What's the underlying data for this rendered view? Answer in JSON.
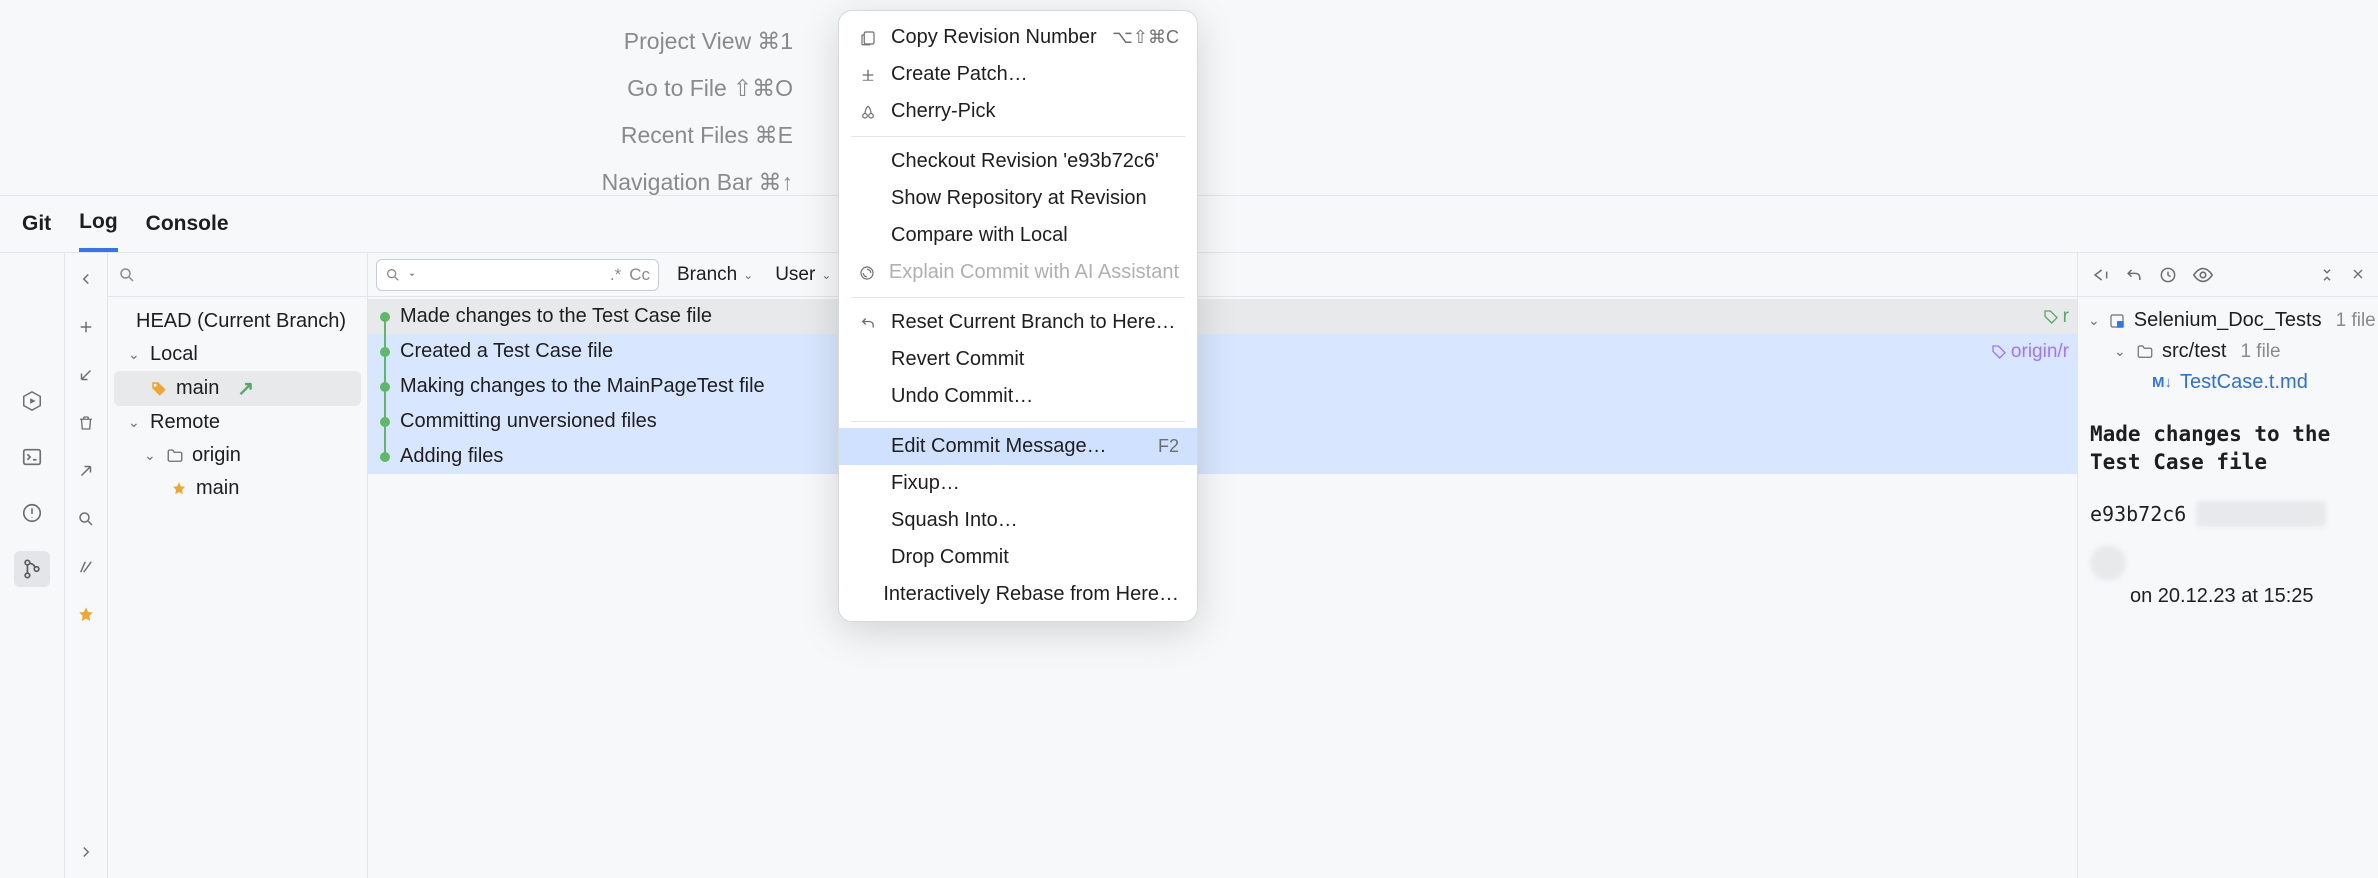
{
  "hints": [
    {
      "label": "Project View",
      "shortcut": "⌘1"
    },
    {
      "label": "Go to File",
      "shortcut": "⇧⌘O"
    },
    {
      "label": "Recent Files",
      "shortcut": "⌘E"
    },
    {
      "label": "Navigation Bar",
      "shortcut": "⌘↑"
    }
  ],
  "tabs": {
    "git": "Git",
    "log": "Log",
    "console": "Console"
  },
  "tree": {
    "head": "HEAD (Current Branch)",
    "local": "Local",
    "local_main": "main",
    "remote": "Remote",
    "origin": "origin",
    "remote_main": "main"
  },
  "filters": {
    "regex": ".*",
    "matchcase": "Cc",
    "branch": "Branch",
    "user": "User"
  },
  "commits": [
    {
      "msg": "Made changes to the Test Case file",
      "tag": "r",
      "tagtype": "green"
    },
    {
      "msg": "Created a Test Case file",
      "tag": "origin/r",
      "tagtype": "purple"
    },
    {
      "msg": "Making changes to the MainPageTest file"
    },
    {
      "msg": "Committing unversioned files"
    },
    {
      "msg": "Adding files"
    }
  ],
  "details": {
    "project": "Selenium_Doc_Tests",
    "project_count": "1 file",
    "folder": "src/test",
    "folder_count": "1 file",
    "file": "TestCase.t.md",
    "message": "Made changes to the Test Case file",
    "hash": "e93b72c6",
    "meta": "on 20.12.23 at 15:25"
  },
  "menu": {
    "copy_rev": "Copy Revision Number",
    "copy_rev_sc": "⌥⇧⌘C",
    "create_patch": "Create Patch…",
    "cherry_pick": "Cherry-Pick",
    "checkout": "Checkout Revision 'e93b72c6'",
    "show_repo": "Show Repository at Revision",
    "compare": "Compare with Local",
    "explain": "Explain Commit with AI Assistant",
    "reset": "Reset Current Branch to Here…",
    "revert": "Revert Commit",
    "undo": "Undo Commit…",
    "edit": "Edit Commit Message…",
    "edit_sc": "F2",
    "fixup": "Fixup…",
    "squash": "Squash Into…",
    "drop": "Drop Commit",
    "rebase": "Interactively Rebase from Here…"
  }
}
